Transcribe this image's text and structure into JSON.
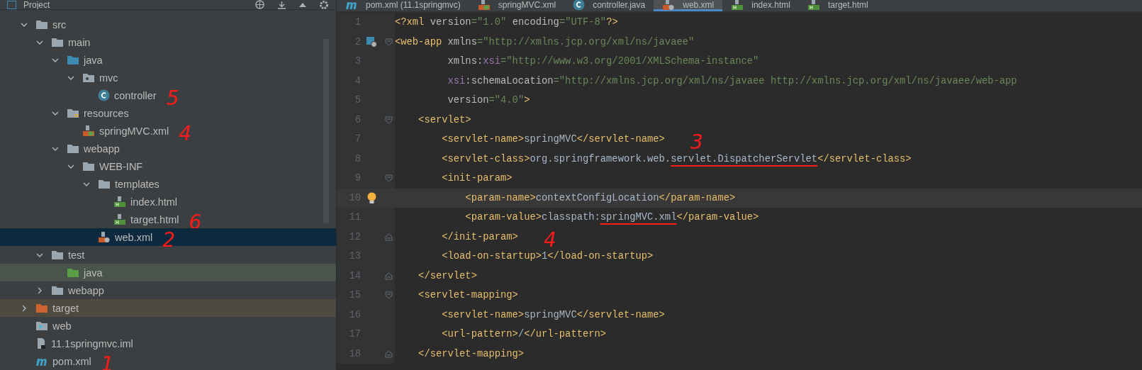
{
  "project_panel": {
    "title": "Project",
    "tree": [
      {
        "label": "src",
        "kind": "folder",
        "expanded": true,
        "selected": false,
        "children": [
          {
            "label": "main",
            "kind": "folder",
            "expanded": true,
            "selected": false,
            "children": [
              {
                "label": "java",
                "kind": "source-folder",
                "expanded": true,
                "selected": false,
                "children": [
                  {
                    "label": "mvc",
                    "kind": "package",
                    "expanded": true,
                    "selected": false,
                    "children": [
                      {
                        "label": "controller",
                        "kind": "class",
                        "selected": false,
                        "note": "5"
                      }
                    ]
                  }
                ]
              },
              {
                "label": "resources",
                "kind": "resource-folder",
                "expanded": true,
                "selected": false,
                "children": [
                  {
                    "label": "springMVC.xml",
                    "kind": "spring-xml",
                    "selected": false,
                    "note": "4"
                  }
                ]
              },
              {
                "label": "webapp",
                "kind": "folder",
                "expanded": true,
                "selected": false,
                "children": [
                  {
                    "label": "WEB-INF",
                    "kind": "folder",
                    "expanded": true,
                    "selected": false,
                    "children": [
                      {
                        "label": "templates",
                        "kind": "folder",
                        "expanded": true,
                        "selected": false,
                        "children": [
                          {
                            "label": "index.html",
                            "kind": "html",
                            "selected": false
                          },
                          {
                            "label": "target.html",
                            "kind": "html",
                            "selected": false,
                            "note": "6"
                          }
                        ]
                      },
                      {
                        "label": "web.xml",
                        "kind": "web-xml",
                        "selected": true,
                        "note": "2"
                      }
                    ]
                  }
                ]
              }
            ]
          },
          {
            "label": "test",
            "kind": "folder",
            "expanded": true,
            "selected": false,
            "children": [
              {
                "label": "java",
                "kind": "test-folder",
                "selected": false
              }
            ]
          },
          {
            "label": "webapp",
            "kind": "folder",
            "expanded": false,
            "selected": false
          }
        ]
      },
      {
        "label": "target",
        "kind": "excluded-folder",
        "expanded": false,
        "selected": false
      },
      {
        "label": "web",
        "kind": "web-module",
        "selected": false
      },
      {
        "label": "11.1springmvc.iml",
        "kind": "iml",
        "selected": false
      },
      {
        "label": "pom.xml",
        "kind": "maven",
        "selected": false,
        "note": "1"
      }
    ]
  },
  "editor": {
    "tabs": [
      {
        "label": "pom.xml (11.1springmvc)",
        "kind": "maven",
        "selected": false
      },
      {
        "label": "springMVC.xml",
        "kind": "spring-xml",
        "selected": false
      },
      {
        "label": "controller.java",
        "kind": "class",
        "selected": false
      },
      {
        "label": "web.xml",
        "kind": "web-xml",
        "selected": true
      },
      {
        "label": "index.html",
        "kind": "html",
        "selected": false
      },
      {
        "label": "target.html",
        "kind": "html",
        "selected": false
      }
    ],
    "lines": [
      {
        "number": "1",
        "tokens": [
          {
            "t": "<?xml ",
            "kind": "tag"
          },
          {
            "t": "version",
            "kind": "attr"
          },
          {
            "t": "=\"1.0\" ",
            "kind": "value"
          },
          {
            "t": "encoding",
            "kind": "attr"
          },
          {
            "t": "=\"UTF-8\"",
            "kind": "value"
          },
          {
            "t": "?>",
            "kind": "tag"
          }
        ]
      },
      {
        "number": "2",
        "web_marker": true,
        "fold_start": true,
        "tokens": [
          {
            "t": "<web-app ",
            "kind": "tag"
          },
          {
            "t": "xmlns",
            "kind": "attr"
          },
          {
            "t": "=\"http://xmlns.jcp.org/xml/ns/javaee\"",
            "kind": "value"
          }
        ]
      },
      {
        "number": "3",
        "tokens": [
          {
            "t": "         xmlns:",
            "kind": "attr"
          },
          {
            "t": "xsi",
            "kind": "ns"
          },
          {
            "t": "=\"http://www.w3.org/2001/XMLSchema-instance\"",
            "kind": "value"
          }
        ]
      },
      {
        "number": "4",
        "tokens": [
          {
            "t": "         xsi",
            "kind": "ns"
          },
          {
            "t": ":schemaLocation",
            "kind": "attr"
          },
          {
            "t": "=\"http://xmlns.jcp.org/xml/ns/javaee http://xmlns.jcp.org/xml/ns/javaee/web-app",
            "kind": "value"
          }
        ]
      },
      {
        "number": "5",
        "tokens": [
          {
            "t": "         version",
            "kind": "attr"
          },
          {
            "t": "=\"4.0\"",
            "kind": "value"
          },
          {
            "t": ">",
            "kind": "tag"
          }
        ]
      },
      {
        "number": "6",
        "fold_start": true,
        "tokens": [
          {
            "t": "    <servlet>",
            "kind": "tag"
          }
        ]
      },
      {
        "number": "7",
        "note": "3",
        "tokens": [
          {
            "t": "        <servlet-name>",
            "kind": "tag"
          },
          {
            "t": "springMVC",
            "kind": "text"
          },
          {
            "t": "</servlet-name>",
            "kind": "tag"
          }
        ]
      },
      {
        "number": "8",
        "tokens": [
          {
            "t": "        <servlet-class>",
            "kind": "tag"
          },
          {
            "t": "org.springframework.web.",
            "kind": "text"
          },
          {
            "t": "servlet.DispatcherServlet",
            "kind": "text",
            "underlined": true
          },
          {
            "t": "</servlet-class>",
            "kind": "tag"
          }
        ]
      },
      {
        "number": "9",
        "fold_start": true,
        "tokens": [
          {
            "t": "        <init-param>",
            "kind": "tag"
          }
        ]
      },
      {
        "number": "10",
        "current": true,
        "bulb": true,
        "tokens": [
          {
            "t": "            <param-name>",
            "kind": "tag"
          },
          {
            "t": "contextConfigLocation",
            "kind": "text"
          },
          {
            "t": "</param-name>",
            "kind": "tag"
          }
        ]
      },
      {
        "number": "11",
        "tokens": [
          {
            "t": "            <param-value>",
            "kind": "tag"
          },
          {
            "t": "classpath:",
            "kind": "text"
          },
          {
            "t": "springMVC.xml",
            "kind": "text",
            "underlined": true
          },
          {
            "t": "</param-value>",
            "kind": "tag"
          }
        ]
      },
      {
        "number": "12",
        "fold_end": true,
        "note": "4",
        "tokens": [
          {
            "t": "        </init-param>",
            "kind": "tag"
          }
        ]
      },
      {
        "number": "13",
        "tokens": [
          {
            "t": "        <load-on-startup>",
            "kind": "tag"
          },
          {
            "t": "1",
            "kind": "text"
          },
          {
            "t": "</load-on-startup>",
            "kind": "tag"
          }
        ]
      },
      {
        "number": "14",
        "fold_end": true,
        "tokens": [
          {
            "t": "    </servlet>",
            "kind": "tag"
          }
        ]
      },
      {
        "number": "15",
        "fold_start": true,
        "tokens": [
          {
            "t": "    <servlet-mapping>",
            "kind": "tag"
          }
        ]
      },
      {
        "number": "16",
        "tokens": [
          {
            "t": "        <servlet-name>",
            "kind": "tag"
          },
          {
            "t": "springMVC",
            "kind": "text"
          },
          {
            "t": "</servlet-name>",
            "kind": "tag"
          }
        ]
      },
      {
        "number": "17",
        "tokens": [
          {
            "t": "        <url-pattern>",
            "kind": "tag"
          },
          {
            "t": "/",
            "kind": "text"
          },
          {
            "t": "</url-pattern>",
            "kind": "tag"
          }
        ]
      },
      {
        "number": "18",
        "fold_end": true,
        "tokens": [
          {
            "t": "    </servlet-mapping>",
            "kind": "tag"
          }
        ]
      }
    ]
  }
}
